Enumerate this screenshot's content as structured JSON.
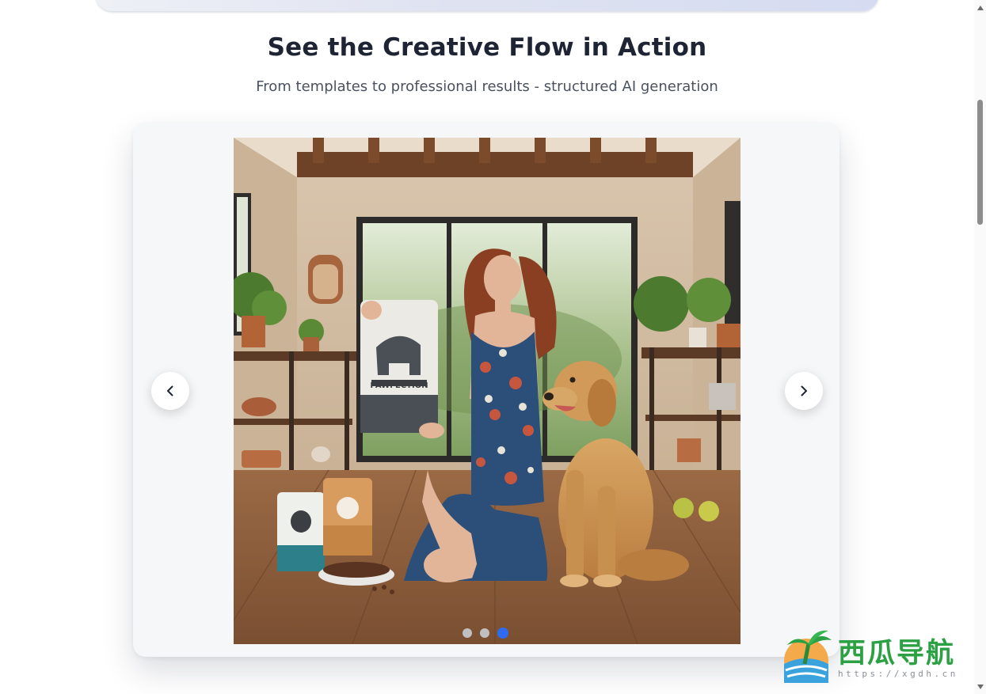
{
  "section": {
    "title": "See the Creative Flow in Action",
    "subtitle": "From templates to professional results - structured AI generation"
  },
  "carousel": {
    "slide": {
      "image": "woman-with-golden-retriever-holding-pet-food-bag",
      "product_brand": "PAWFECTION"
    },
    "prev_icon": "chevron-left-icon",
    "next_icon": "chevron-right-icon",
    "dots_count": 3,
    "active_dot": 3,
    "active_color": "#2f6bf0"
  },
  "watermark": {
    "text": "西瓜导航",
    "url": "https://xgdh.cn",
    "brand_color": "#2ba144"
  }
}
